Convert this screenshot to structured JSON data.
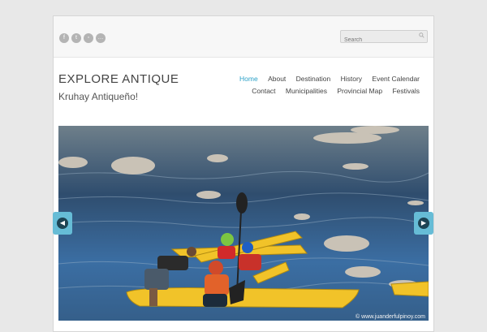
{
  "social": [
    {
      "icon": "facebook-icon",
      "glyph": "f"
    },
    {
      "icon": "twitter-icon",
      "glyph": "t"
    },
    {
      "icon": "rss-icon",
      "glyph": "◦"
    },
    {
      "icon": "chat-icon",
      "glyph": "…"
    }
  ],
  "search": {
    "placeholder": "Search"
  },
  "site": {
    "title": "EXPLORE ANTIQUE",
    "tagline": "Kruhay Antiqueño!"
  },
  "nav": {
    "row1": [
      "Home",
      "About",
      "Destination",
      "History",
      "Event Calendar"
    ],
    "row2": [
      "Contact",
      "Municipalities",
      "Provincial Map",
      "Festivals"
    ],
    "active": "Home"
  },
  "slider": {
    "credit": "© www.juanderfulpinoy.com"
  },
  "colors": {
    "accent": "#2aa0c7",
    "arrow": "#66bcd6",
    "water": "#3f6287",
    "kayak": "#f1c329"
  }
}
